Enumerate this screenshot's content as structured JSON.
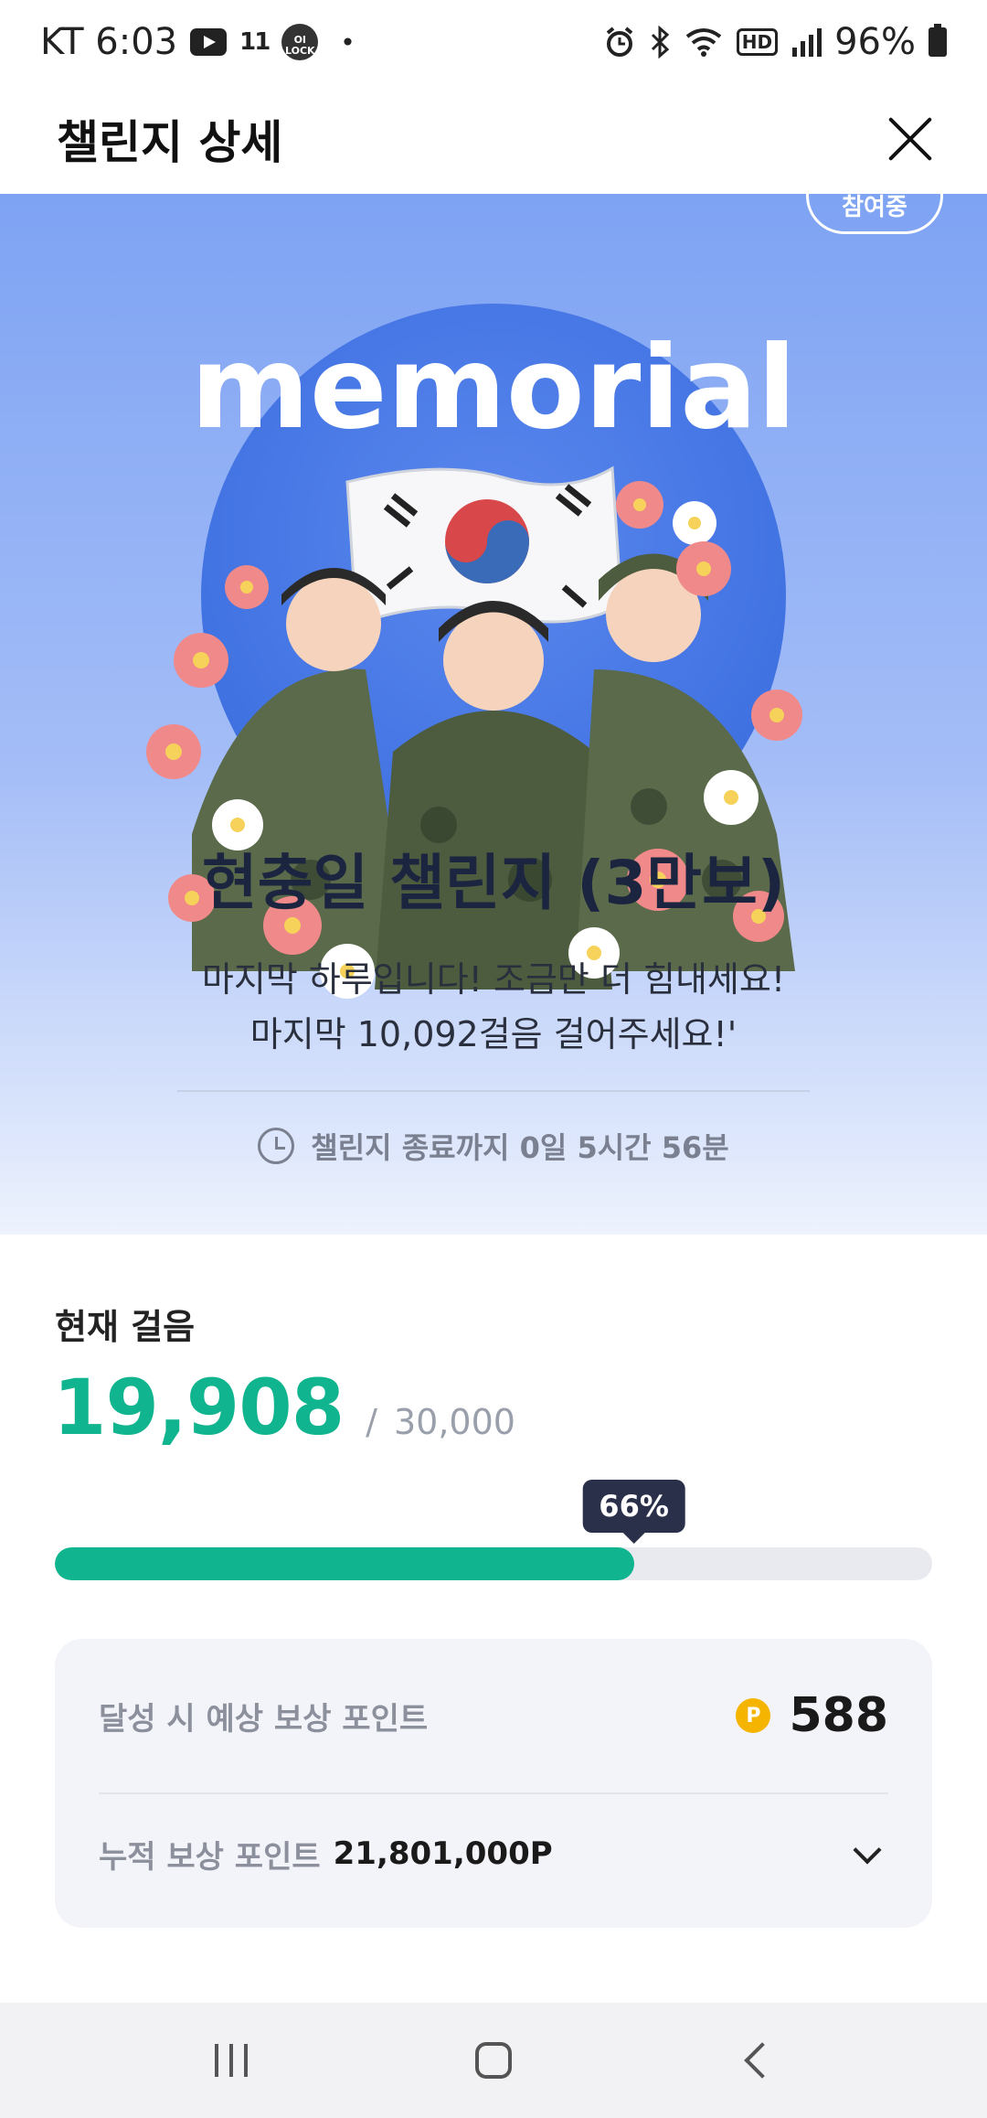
{
  "status_bar": {
    "carrier_time": "KT 6:03",
    "st_label": "11",
    "lock_label": "OI\nLOCK",
    "battery": "96%"
  },
  "header": {
    "title": "챌린지 상세"
  },
  "hero": {
    "status_pill": "참여중",
    "image_text": "memorial",
    "title": "현충일 챌린지 (3만보)",
    "description_line1": "마지막 하루입니다! 조금만 더 힘내세요!",
    "description_line2": "마지막 10,092걸음 걸어주세요!'",
    "remaining_time": "챌린지 종료까지 0일 5시간 56분"
  },
  "steps": {
    "label": "현재 걸음",
    "current": "19,908",
    "separator": "/",
    "goal": "30,000",
    "progress_label": "66%",
    "progress_fraction": 0.66
  },
  "reward": {
    "expected_label": "달성 시 예상 보상 포인트",
    "point_symbol": "P",
    "expected_value": "588",
    "accumulated_label": "누적 보상 포인트",
    "accumulated_value": "21,801,000P"
  },
  "colors": {
    "accent": "#10b48e",
    "tooltip": "#2a2f4a",
    "point_coin": "#f5b400"
  }
}
